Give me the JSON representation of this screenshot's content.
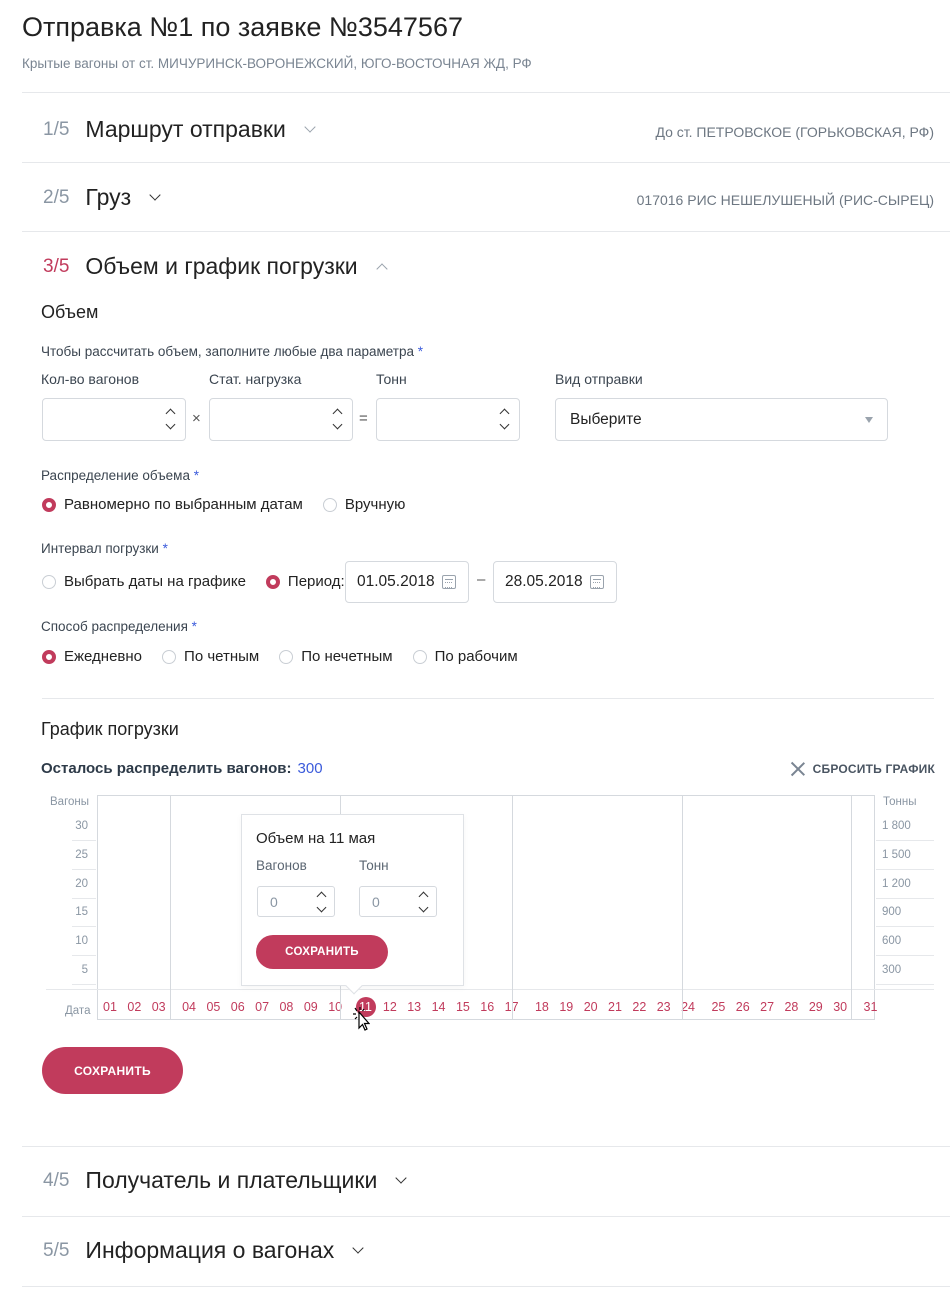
{
  "header": {
    "title": "Отправка №1 по заявке №3547567",
    "subtitle": "Крытые вагоны от ст. МИЧУРИНСК-ВОРОНЕЖСКИЙ, ЮГО-ВОСТОЧНАЯ ЖД, РФ"
  },
  "steps": [
    {
      "num": "1/5",
      "title": "Маршрут отправки",
      "summary": "До ст. ПЕТРОВСКОЕ (ГОРЬКОВСКАЯ, РФ)"
    },
    {
      "num": "2/5",
      "title": "Груз",
      "summary": "017016  РИС НЕШЕЛУШЕНЫЙ (РИС-СЫРЕЦ)"
    },
    {
      "num": "3/5",
      "title": "Объем и график погрузки",
      "summary": ""
    },
    {
      "num": "4/5",
      "title": "Получатель и плательщики",
      "summary": ""
    },
    {
      "num": "5/5",
      "title": "Информация о вагонах",
      "summary": ""
    }
  ],
  "volume": {
    "heading": "Объем",
    "hint": "Чтобы рассчитать объем, заполните любые два параметра",
    "required_mark": "*",
    "fields": {
      "wagons_label": "Кол-во вагонов",
      "wagons_value": "",
      "load_label": "Стат. нагрузка",
      "load_value": "",
      "tons_label": "Тонн",
      "tons_value": "",
      "times_sign": "×",
      "equals_sign": "=",
      "shipment_type_label": "Вид отправки",
      "shipment_type_value": "Выберите"
    },
    "distribution": {
      "label": "Распределение объема",
      "options": [
        {
          "label": "Равномерно по выбранным датам",
          "selected": true
        },
        {
          "label": "Вручную",
          "selected": false
        }
      ]
    },
    "interval": {
      "label": "Интервал погрузки",
      "options": [
        {
          "label": "Выбрать даты на графике",
          "selected": false
        },
        {
          "label": "Период:",
          "selected": true
        }
      ],
      "date_from": "01.05.2018",
      "date_separator": "–",
      "date_to": "28.05.2018"
    },
    "method": {
      "label": "Способ распределения",
      "options": [
        {
          "label": "Ежедневно",
          "selected": true
        },
        {
          "label": "По четным",
          "selected": false
        },
        {
          "label": "По нечетным",
          "selected": false
        },
        {
          "label": "По рабочим",
          "selected": false
        }
      ]
    }
  },
  "schedule": {
    "heading": "График погрузки",
    "remain_label": "Осталось распределить вагонов:",
    "remain_value": "300",
    "reset_label": "СБРОСИТЬ ГРАФИК",
    "save_label": "СОХРАНИТЬ"
  },
  "chart_data": {
    "type": "bar",
    "ylabel_left": "Вагоны",
    "ylabel_right": "Тонны",
    "xlabel": "Дата",
    "y_ticks_left": [
      "30",
      "25",
      "20",
      "15",
      "10",
      "5"
    ],
    "y_ticks_right": [
      "1 800",
      "1 500",
      "1 200",
      "900",
      "600",
      "300"
    ],
    "categories": [
      "01",
      "02",
      "03",
      "04",
      "05",
      "06",
      "07",
      "08",
      "09",
      "10",
      "11",
      "12",
      "13",
      "14",
      "15",
      "16",
      "17",
      "18",
      "19",
      "20",
      "21",
      "22",
      "23",
      "24",
      "25",
      "26",
      "27",
      "28",
      "29",
      "30",
      "31"
    ],
    "values": [
      0,
      0,
      0,
      0,
      0,
      0,
      0,
      0,
      0,
      0,
      0,
      0,
      0,
      0,
      0,
      0,
      0,
      0,
      0,
      0,
      0,
      0,
      0,
      0,
      0,
      0,
      0,
      0,
      0,
      0,
      0
    ],
    "selected_category": "11",
    "colors": {
      "accent": "#c13b5c",
      "link": "#3b5bdb"
    }
  },
  "popover": {
    "title": "Объем на 11 мая",
    "wagons_label": "Вагонов",
    "wagons_value": "0",
    "tons_label": "Тонн",
    "tons_value": "0",
    "save_label": "СОХРАНИТЬ"
  }
}
